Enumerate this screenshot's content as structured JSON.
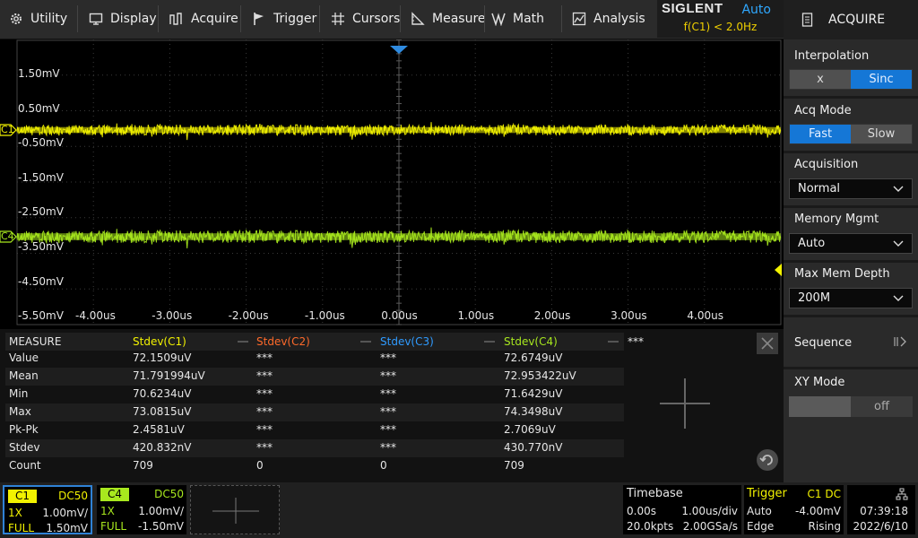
{
  "menu": {
    "items": [
      {
        "label": "Utility",
        "icon": "gear-icon"
      },
      {
        "label": "Display",
        "icon": "monitor-icon"
      },
      {
        "label": "Acquire",
        "icon": "acquire-icon"
      },
      {
        "label": "Trigger",
        "icon": "flag-icon"
      },
      {
        "label": "Cursors",
        "icon": "crosshair-icon"
      },
      {
        "label": "Measure",
        "icon": "ruler-icon"
      },
      {
        "label": "Math",
        "icon": "math-icon"
      },
      {
        "label": "Analysis",
        "icon": "analysis-icon"
      }
    ]
  },
  "brand": {
    "logo": "SIGLENT",
    "mode": "Auto",
    "freq": "f(C1) < 2.0Hz"
  },
  "panel": {
    "title": "ACQUIRE",
    "interpolation": {
      "label": "Interpolation",
      "options": [
        "x",
        "Sinc"
      ],
      "selected": "Sinc"
    },
    "acq_mode": {
      "label": "Acq Mode",
      "options": [
        "Fast",
        "Slow"
      ],
      "selected": "Fast"
    },
    "acquisition": {
      "label": "Acquisition",
      "value": "Normal"
    },
    "memory_mgmt": {
      "label": "Memory Mgmt",
      "value": "Auto"
    },
    "max_mem_depth": {
      "label": "Max Mem Depth",
      "value": "200M"
    },
    "sequence": {
      "label": "Sequence"
    },
    "xy_mode": {
      "label": "XY Mode",
      "value": "off"
    }
  },
  "grid": {
    "y_labels": [
      "1.50mV",
      "0.50mV",
      "-0.50mV",
      "-1.50mV",
      "-2.50mV",
      "-3.50mV",
      "-4.50mV",
      "-5.50mV"
    ],
    "x_labels": [
      "-4.00us",
      "-3.00us",
      "-2.00us",
      "-1.00us",
      "0.00us",
      "1.00us",
      "2.00us",
      "3.00us",
      "4.00us"
    ],
    "ch1_marker": "C1",
    "ch4_marker": "C4",
    "colors": {
      "c1": "#f2f200",
      "c4": "#a8e81e",
      "c2": "#ff6a2a",
      "c3": "#2f9bff"
    }
  },
  "measure": {
    "header": [
      "MEASURE",
      "Stdev(C1)",
      "Stdev(C2)",
      "Stdev(C3)",
      "Stdev(C4)",
      "***"
    ],
    "rows": [
      [
        "Value",
        "72.1509uV",
        "***",
        "***",
        "72.6749uV"
      ],
      [
        "Mean",
        "71.791994uV",
        "***",
        "***",
        "72.953422uV"
      ],
      [
        "Min",
        "70.6234uV",
        "***",
        "***",
        "71.6429uV"
      ],
      [
        "Max",
        "73.0815uV",
        "***",
        "***",
        "74.3498uV"
      ],
      [
        "Pk-Pk",
        "2.4581uV",
        "***",
        "***",
        "2.7069uV"
      ],
      [
        "Stdev",
        "420.832nV",
        "***",
        "***",
        "430.770nV"
      ],
      [
        "Count",
        "709",
        "0",
        "0",
        "709"
      ]
    ]
  },
  "channels": [
    {
      "name": "C1",
      "coupling": "DC50",
      "probe": "1X",
      "scale": "1.00mV/",
      "bw": "FULL",
      "offset": "1.50mV"
    },
    {
      "name": "C4",
      "coupling": "DC50",
      "probe": "1X",
      "scale": "1.00mV/",
      "bw": "FULL",
      "offset": "-1.50mV"
    }
  ],
  "timebase": {
    "label": "Timebase",
    "delay": "0.00s",
    "scale": "1.00us/div",
    "points": "20.0kpts",
    "rate": "2.00GSa/s"
  },
  "trigger": {
    "label": "Trigger",
    "source": "C1 DC",
    "mode": "Auto",
    "level": "-4.00mV",
    "type": "Edge",
    "slope": "Rising"
  },
  "clock": {
    "time": "07:39:18",
    "date": "2022/6/10"
  }
}
